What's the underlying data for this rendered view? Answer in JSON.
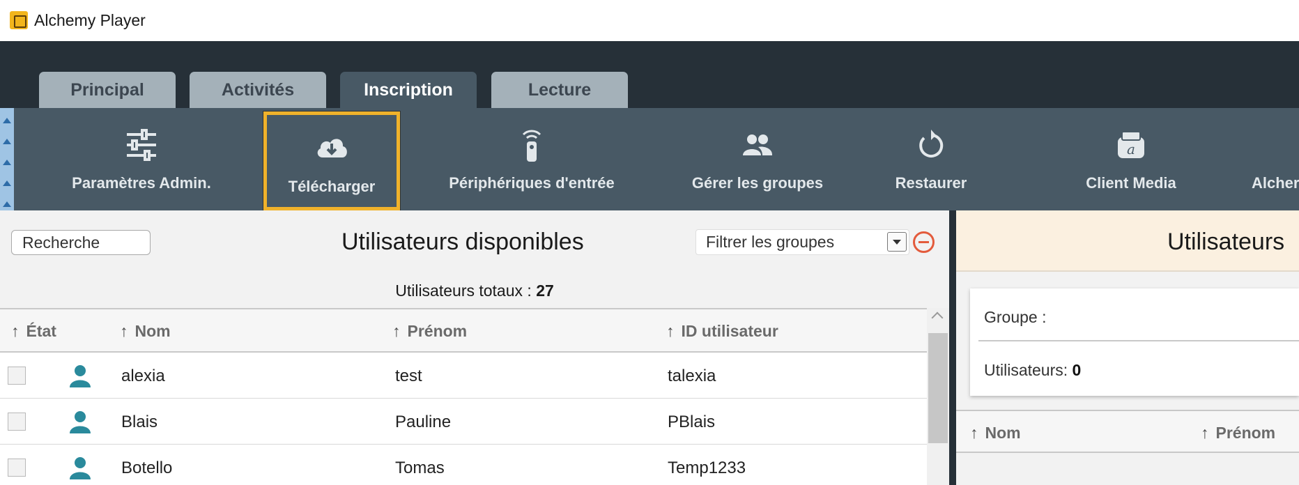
{
  "app": {
    "title": "Alchemy Player"
  },
  "tabs": [
    {
      "label": "Principal",
      "active": false
    },
    {
      "label": "Activités",
      "active": false
    },
    {
      "label": "Inscription",
      "active": true
    },
    {
      "label": "Lecture",
      "active": false
    }
  ],
  "toolbar": {
    "items": [
      {
        "label": "Paramètres Admin.",
        "icon": "sliders-icon"
      },
      {
        "label": "Télécharger",
        "icon": "cloud-download-icon",
        "highlighted": true
      },
      {
        "label": "Périphériques d'entrée",
        "icon": "remote-control-icon"
      },
      {
        "label": "Gérer les groupes",
        "icon": "users-group-icon"
      },
      {
        "label": "Restaurer",
        "icon": "restore-icon"
      },
      {
        "label": "Client Media",
        "icon": "media-client-icon"
      },
      {
        "label": "Alcher",
        "icon": ""
      }
    ]
  },
  "available_users": {
    "search_placeholder": "Recherche",
    "title": "Utilisateurs disponibles",
    "filter_label": "Filtrer les groupes",
    "total_label": "Utilisateurs totaux : ",
    "total_value": "27",
    "columns": [
      "État",
      "Nom",
      "Prénom",
      "ID utilisateur"
    ],
    "rows": [
      {
        "nom": "alexia",
        "prenom": "test",
        "id": "talexia"
      },
      {
        "nom": "Blais",
        "prenom": "Pauline",
        "id": "PBlais"
      },
      {
        "nom": "Botello",
        "prenom": "Tomas",
        "id": "Temp1233"
      }
    ]
  },
  "group_users": {
    "title": "Utilisateurs",
    "group_label": "Groupe :",
    "users_label": "Utilisateurs: ",
    "users_value": "0",
    "columns": [
      "Nom",
      "Prénom"
    ]
  },
  "colors": {
    "accent": "#f0b22b",
    "user_icon": "#2a8a9c",
    "remove": "#e35b3c"
  }
}
